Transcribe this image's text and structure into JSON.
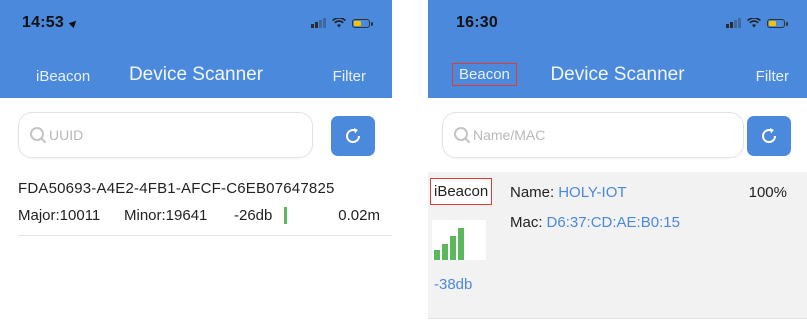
{
  "left_phone": {
    "time": "14:53",
    "nav": {
      "left": "iBeacon",
      "title": "Device Scanner",
      "right": "Filter"
    },
    "search_placeholder": "UUID",
    "result": {
      "uuid": "FDA50693-A4E2-4FB1-AFCF-C6EB07647825",
      "major": "Major:10011",
      "minor": "Minor:19641",
      "rssi": "-26db",
      "distance": "0.02m"
    }
  },
  "right_phone": {
    "time": "16:30",
    "nav": {
      "left": "Beacon",
      "title": "Device Scanner",
      "right": "Filter"
    },
    "search_placeholder": "Name/MAC",
    "device": {
      "type_badge": "iBeacon",
      "name_label": "Name:",
      "name": "HOLY-IOT",
      "mac_label": "Mac:",
      "mac": "D6:37:CD:AE:B0:15",
      "percent": "100%",
      "rssi": "-38db"
    }
  },
  "colors": {
    "accent": "#4a89dc",
    "signal": "#5cb85c",
    "highlight": "#e53935"
  }
}
